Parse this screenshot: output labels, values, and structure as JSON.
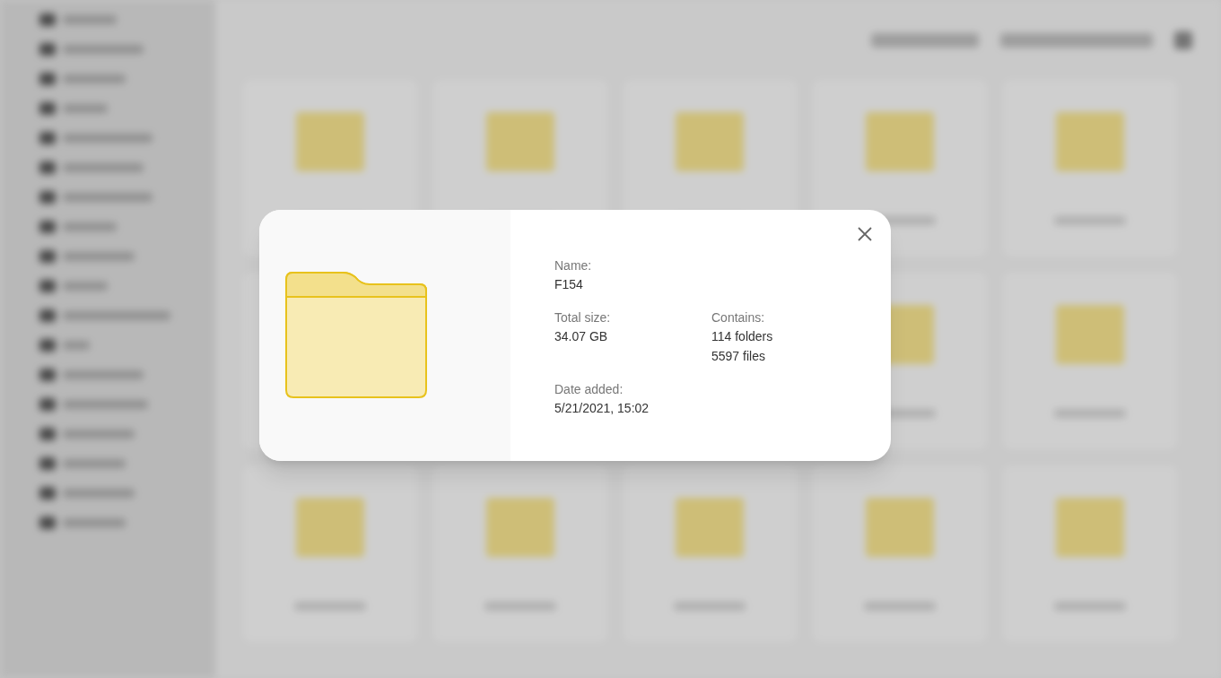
{
  "dialog": {
    "rows": [
      [
        {
          "label": "Name:",
          "values": [
            "F154"
          ]
        }
      ],
      [
        {
          "label": "Total size:",
          "values": [
            "34.07 GB"
          ]
        },
        {
          "label": "Contains:",
          "values": [
            "114 folders",
            "5597 files"
          ]
        }
      ],
      [
        {
          "label": "Date added:",
          "values": [
            "5/21/2021, 15:02"
          ]
        }
      ]
    ]
  }
}
